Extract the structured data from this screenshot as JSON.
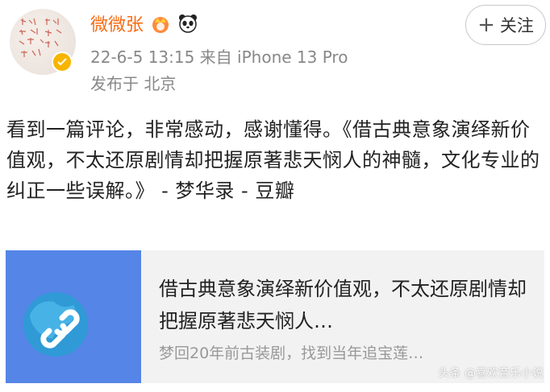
{
  "user": {
    "name": "微微张",
    "avatar_icon": "calligraphy-avatar",
    "verified_icon": "verified-badge-icon",
    "badge_icons": [
      "crown-icon",
      "panda-icon"
    ]
  },
  "follow_button": {
    "plus": "+",
    "label": "关注"
  },
  "post_meta": {
    "date_source": "22-6-5 13:15  来自 iPhone 13 Pro",
    "location": "发布于 北京"
  },
  "post": {
    "text": "看到一篇评论，非常感动，感谢懂得。《借古典意象演绎新价值观，不太还原剧情却把握原著悲天悯人的神髓，文化专业的纠正一些误解。》 - 梦华录 - 豆瓣"
  },
  "link_card": {
    "icon": "link-icon",
    "title": "借古典意象演绎新价值观，不太还原剧情却把握原著悲天悯人…",
    "description": "梦回20年前古装剧，找到当年追宝莲…"
  },
  "watermark": "头条 @喜欢音乐小说",
  "colors": {
    "username": "#f86c15",
    "meta": "#888888",
    "card_bg": "#f2f2f2",
    "thumb_bg": "#5585e6"
  }
}
